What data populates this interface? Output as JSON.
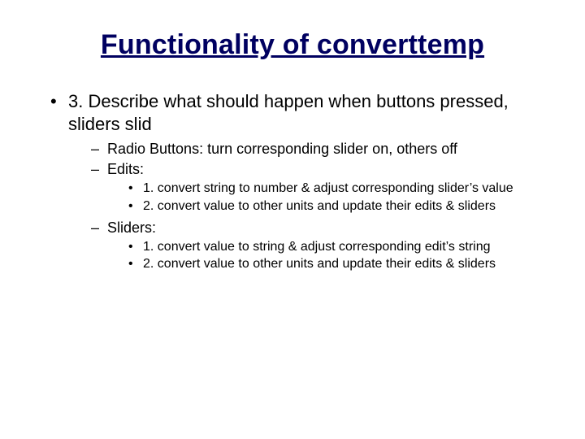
{
  "title": "Functionality of converttemp",
  "bullets": {
    "lvl1_item1": "3. Describe what should happen when buttons pressed, sliders slid",
    "lvl2_item1": "Radio Buttons: turn corresponding slider on, others off",
    "lvl2_item2": "Edits:",
    "edits_sub1": "1. convert string to number & adjust corresponding slider’s value",
    "edits_sub2": "2. convert value to other units and update their edits & sliders",
    "lvl2_item3": "Sliders:",
    "sliders_sub1": "1. convert value to string & adjust corresponding edit’s string",
    "sliders_sub2": "2. convert value to other units and update their edits & sliders"
  }
}
